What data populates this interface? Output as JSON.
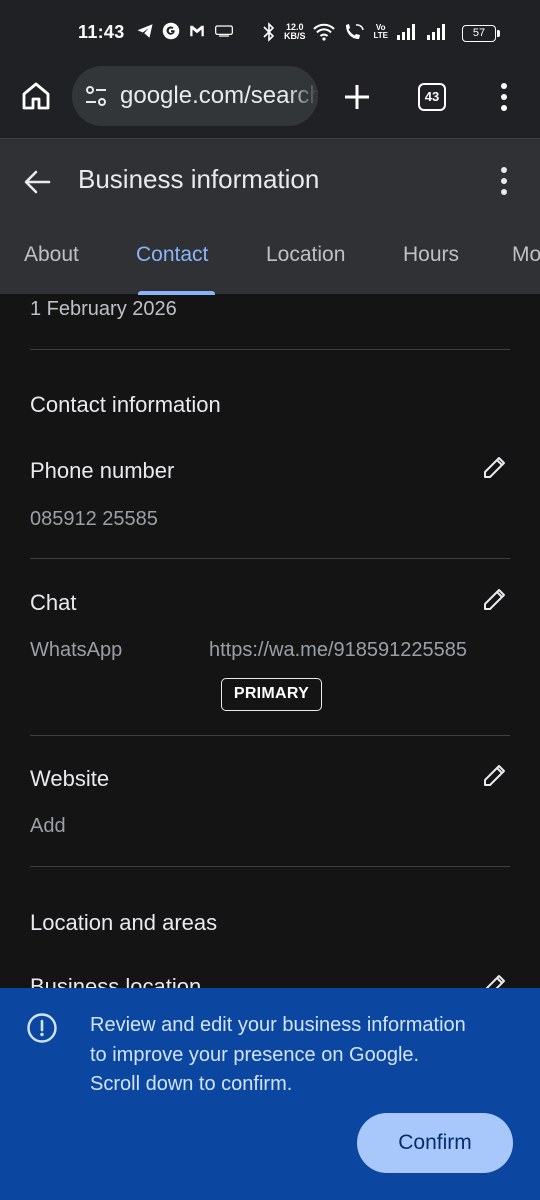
{
  "status_bar": {
    "time": "11:43",
    "net_speed_value": "12.0",
    "net_speed_unit": "KB/S",
    "volte_top": "Vo",
    "volte_bottom": "LTE",
    "battery": "57"
  },
  "browser": {
    "url": "google.com/search",
    "tab_count": "43"
  },
  "header": {
    "title": "Business information"
  },
  "tabs": [
    {
      "label": "About"
    },
    {
      "label": "Contact"
    },
    {
      "label": "Location"
    },
    {
      "label": "Hours"
    },
    {
      "label": "More"
    }
  ],
  "active_tab": "Contact",
  "content": {
    "date": "1 February 2026",
    "contact_section_title": "Contact information",
    "phone": {
      "label": "Phone number",
      "value": "085912 25585"
    },
    "chat": {
      "label": "Chat",
      "app": "WhatsApp",
      "link": "https://wa.me/918591225585",
      "badge": "PRIMARY"
    },
    "website": {
      "label": "Website",
      "value": "Add"
    },
    "location_section_title": "Location and areas",
    "business_location_label": "Business location"
  },
  "banner": {
    "line1": "Review and edit your business information",
    "line2": "to improve your presence on Google.",
    "line3": "Scroll down to confirm.",
    "confirm_label": "Confirm"
  },
  "colors": {
    "accent": "#8ab4f8",
    "banner_bg": "#0b47a1",
    "confirm_bg": "#a8c7fa",
    "page_bg": "#141414",
    "header_bg": "#303134"
  },
  "icons": {
    "home": "home-icon",
    "site_settings": "tune-icon",
    "new_tab": "plus-icon",
    "menu": "more-vert-icon",
    "back": "arrow-back-icon",
    "edit": "pencil-icon",
    "info": "info-icon"
  }
}
